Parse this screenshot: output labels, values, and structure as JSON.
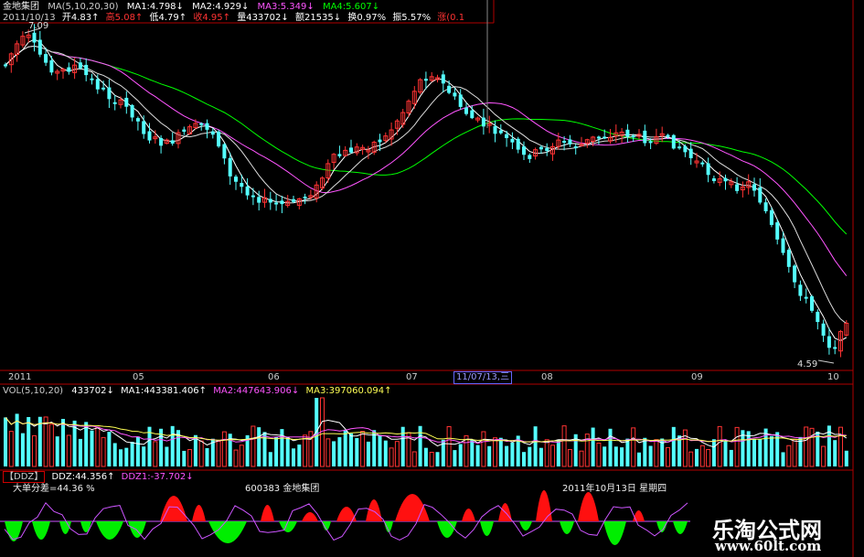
{
  "header": {
    "stock_name": "金地集团",
    "ma_label": "MA(5,10,20,30)",
    "ma1": "MA1:4.798↓",
    "ma2": "MA2:4.929↓",
    "ma3": "MA3:5.349↓",
    "ma4": "MA4:5.607↓",
    "date": "2011/10/13",
    "open": "开4.83↑",
    "high": "高5.08↑",
    "low": "低4.79↑",
    "close": "收4.95↑",
    "volume": "量433702↓",
    "amount": "额21535↓",
    "turnover": "换0.97%",
    "amplitude": "振5.57%",
    "change": "涨(0.1"
  },
  "price_chart": {
    "high_marker": "7.09",
    "low_marker": "4.59",
    "axis_labels": [
      "2011",
      "05",
      "06",
      "07",
      "08",
      "09",
      "10"
    ],
    "cursor_date": "11/07/13,三"
  },
  "volume_panel": {
    "label": "VOL(5,10,20)",
    "value": "433702↓",
    "ma1": "MA1:443381.406↑",
    "ma2": "MA2:447643.906↓",
    "ma3": "MA3:397060.094↑"
  },
  "ddz_panel": {
    "tag": "【DDZ】",
    "ddz": "DDZ:44.356↑",
    "ddz1": "DDZ1:-37.702↓",
    "big_order": "大单分差=44.36 %",
    "stock_code_name": "600383 金地集团",
    "date_label": "2011年10月13日 星期四"
  },
  "watermark": {
    "title": "乐淘公式网",
    "url": "www.60lt.com"
  },
  "colors": {
    "up": "#ff3333",
    "down": "#54ffff",
    "ma1": "#ffffff",
    "ma2": "#ffffff",
    "ma3": "#ff55ff",
    "ma4": "#00ff00",
    "panel_border": "#b00000",
    "green_fill": "#00ee00",
    "red_fill": "#ff1010",
    "ddz1_line": "#cc55ff"
  }
}
